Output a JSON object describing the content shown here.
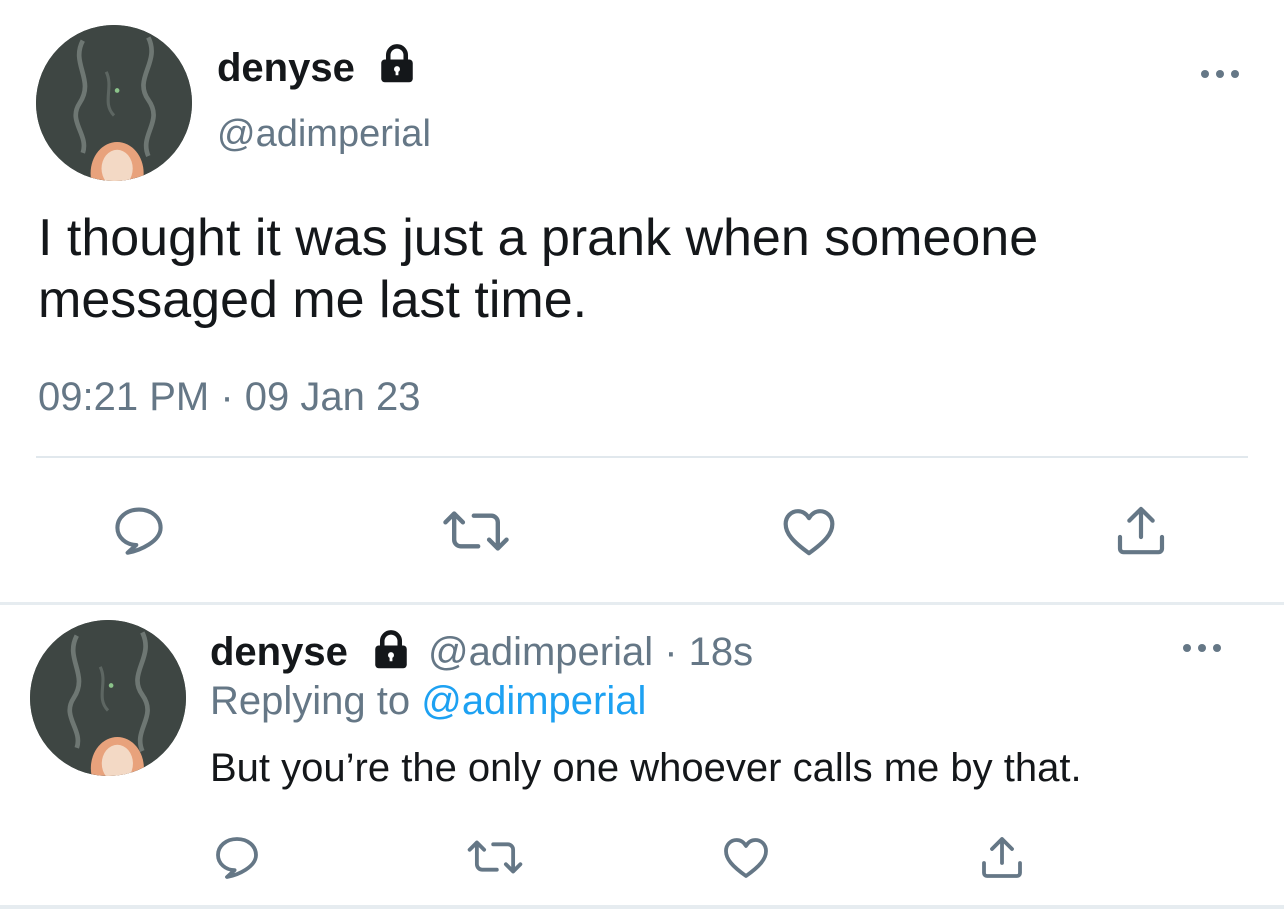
{
  "main_tweet": {
    "author_name": "denyse",
    "handle": "@adimperial",
    "text_line1": "I thought it was just a prank when someone",
    "text_line2": "messaged me last time.",
    "timestamp": "09:21 PM · 09 Jan 23"
  },
  "reply_tweet": {
    "author_name": "denyse",
    "handle_time": "@adimperial · 18s",
    "replying_prefix": "Replying to ",
    "replying_to": "@adimperial",
    "text": "But you’re the only one whoever calls me by that."
  },
  "icons": {
    "lock": "lock-icon",
    "more": "more-options-icon",
    "reply": "reply-icon",
    "retweet": "retweet-icon",
    "like": "like-icon",
    "share": "share-icon"
  },
  "colors": {
    "text": "#14171a",
    "secondary": "#657786",
    "link": "#1da1f2",
    "divider": "#e1e8ed"
  }
}
